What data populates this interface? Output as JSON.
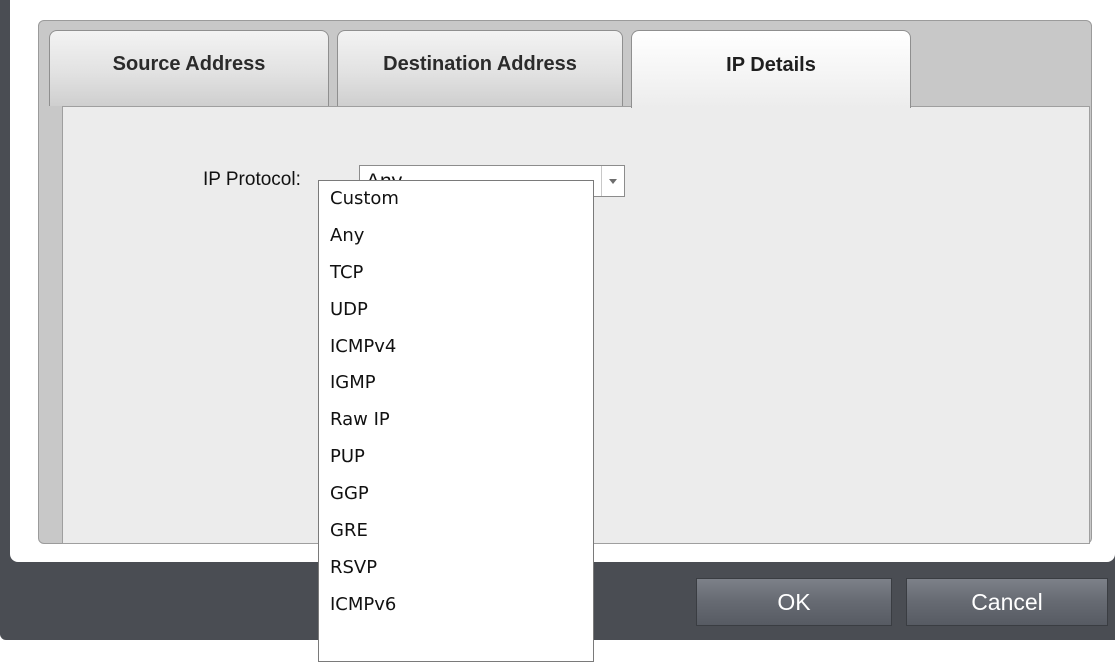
{
  "tabs": [
    {
      "label": "Source Address"
    },
    {
      "label": "Destination Address"
    },
    {
      "label": "IP Details"
    }
  ],
  "ip_details": {
    "protocol_label": "IP Protocol:",
    "protocol_value": "Any"
  },
  "dropdown": {
    "options": [
      "Custom",
      "Any",
      "TCP",
      "UDP",
      "ICMPv4",
      "IGMP",
      "Raw IP",
      "PUP",
      "GGP",
      "GRE",
      "RSVP",
      "ICMPv6"
    ]
  },
  "buttons": {
    "ok_label": "OK",
    "cancel_label": "Cancel"
  },
  "colors": {
    "frame": "#4a4d53",
    "tab_panel": "#ececec",
    "button": "#666a72"
  },
  "icons": {
    "combo_arrow": "chevron-down-icon"
  }
}
